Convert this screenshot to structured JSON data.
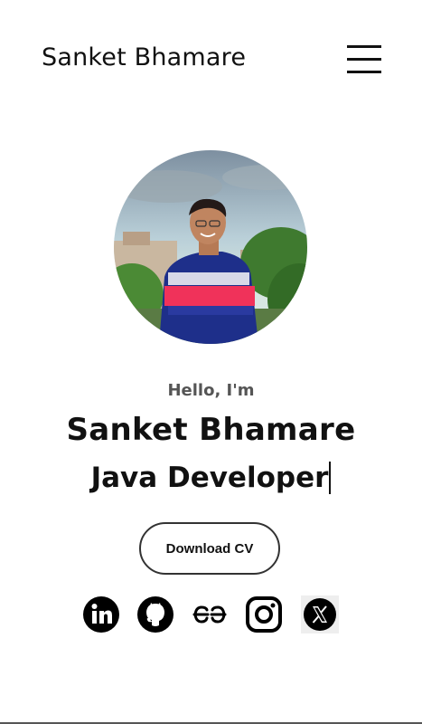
{
  "header": {
    "brand": "Sanket Bhamare",
    "menu_icon": "hamburger-menu-icon"
  },
  "hero": {
    "greeting": "Hello, I'm",
    "name": "Sanket Bhamare",
    "role": "Java Developer",
    "download_label": "Download CV"
  },
  "socials": [
    {
      "icon": "linkedin-icon"
    },
    {
      "icon": "github-icon"
    },
    {
      "icon": "geeksforgeeks-icon"
    },
    {
      "icon": "instagram-icon"
    },
    {
      "icon": "x-twitter-icon"
    }
  ]
}
